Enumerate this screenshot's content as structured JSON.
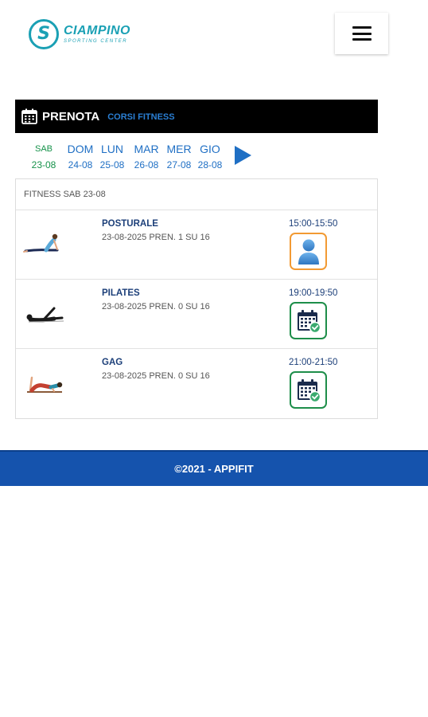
{
  "header": {
    "logo_letter": "S",
    "logo_name": "CIAMPINO",
    "logo_sub": "SPORTING CENTER"
  },
  "bar": {
    "title": "PRENOTA",
    "subtitle": "CORSI FITNESS"
  },
  "days": [
    {
      "name": "SAB",
      "date": "23-08",
      "selected": true
    },
    {
      "name": "DOM",
      "date": "24-08"
    },
    {
      "name": "LUN",
      "date": "25-08"
    },
    {
      "name": "MAR",
      "date": "26-08"
    },
    {
      "name": "MER",
      "date": "27-08"
    },
    {
      "name": "GIO",
      "date": "28-08"
    }
  ],
  "panel": {
    "heading": "FITNESS SAB 23-08",
    "courses": [
      {
        "name": "POSTURALE",
        "info": "23-08-2025 PREN. 1 SU 16",
        "time": "15:00-15:50",
        "action": "person-icon"
      },
      {
        "name": "PILATES",
        "info": "23-08-2025 PREN. 0 SU 16",
        "time": "19:00-19:50",
        "action": "calendar-check-icon"
      },
      {
        "name": "GAG",
        "info": "23-08-2025 PREN. 0 SU 16",
        "time": "21:00-21:50",
        "action": "calendar-check-icon"
      }
    ]
  },
  "footer": {
    "text": "©2021 - APPIFIT"
  },
  "colors": {
    "brand": "#1aa0b4",
    "accent_blue": "#1f6fc4",
    "selected_green": "#16924a",
    "footer_blue": "#1553ad",
    "full_orange": "#f29a33",
    "book_green": "#1e8e4a"
  }
}
